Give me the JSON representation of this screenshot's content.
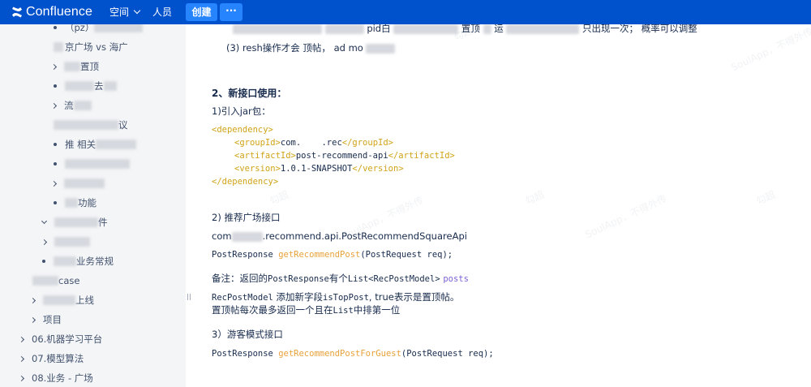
{
  "app": {
    "name": "Confluence",
    "brand_color": "#0052cc",
    "button_color": "#2684ff"
  },
  "topbar": {
    "spaces_label": "空间",
    "people_label": "人员",
    "create_label": "创建",
    "more_label": "···"
  },
  "sidebar": {
    "items": [
      {
        "label": "（pz）",
        "kind": "bullet"
      },
      {
        "label": "京广场 vs 海广",
        "kind": "text"
      },
      {
        "label": "置顶",
        "kind": "caret"
      },
      {
        "label": "去",
        "kind": "bullet"
      },
      {
        "label": "流",
        "kind": "caret"
      },
      {
        "label": "议",
        "kind": "text"
      },
      {
        "label": "推 相关",
        "kind": "bullet"
      },
      {
        "label": "",
        "kind": "bullet"
      },
      {
        "label": "",
        "kind": "caret"
      },
      {
        "label": "功能",
        "kind": "bullet"
      },
      {
        "label": "件",
        "kind": "caret-down"
      },
      {
        "label": "",
        "kind": "caret"
      },
      {
        "label": "业务常规",
        "kind": "bullet"
      },
      {
        "label": "case",
        "kind": "text"
      },
      {
        "label": "上线",
        "kind": "caret"
      },
      {
        "label": "项目",
        "kind": "caret"
      },
      {
        "label": "06.机器学习平台",
        "kind": "caret"
      },
      {
        "label": "07.模型算法",
        "kind": "caret"
      },
      {
        "label": "08.业务 - 广场",
        "kind": "caret"
      }
    ]
  },
  "content": {
    "line_top_a": "pid白",
    "line_top_b": "置顶",
    "line_top_c": "运",
    "line_top_d": "只出现一次； 概率可以调整",
    "line_refresh": "(3)      resh操作才会      顶帖， ad mo      ",
    "section2_title": "2、新接口使用：",
    "step1": "1)引入jar包：",
    "code_dep_open": "<dependency>",
    "code_group_open": "<groupId>",
    "code_group_value": "com.    .rec",
    "code_group_close": "</groupId>",
    "code_artifact_open": "<artifactId>",
    "code_artifact_value": "post-recommend-api",
    "code_artifact_close": "</artifactId>",
    "code_version_open": "<version>",
    "code_version_value": "1.0.1-SNAPSHOT",
    "code_version_close": "</version>",
    "code_dep_close": "</dependency>",
    "step2": "2) 推荐广场接口",
    "api_class_prefix": "com",
    "api_class": ".recommend.api.PostRecommendSquareApi",
    "sig1_type": "PostResponse ",
    "sig1_method": "getRecommendPost",
    "sig1_args": "(PostRequest req);",
    "note_prefix": "备注：返回的",
    "note_type": "PostResponse",
    "note_mid": "有个",
    "note_list": "List<RecPostModel>",
    "note_field": "posts",
    "model_line_a": "RecPostModel",
    "model_line_b": " 添加新字段",
    "model_line_c": "isTopPost",
    "model_line_d": ", true表示是置顶帖。",
    "model_line2_a": "置顶帖每次最多返回一个且在",
    "model_line2_b": "List",
    "model_line2_c": "中排第一位",
    "step3": "3）游客模式接口",
    "sig2_type": "PostResponse ",
    "sig2_method": "getRecommendPostForGuest",
    "sig2_args": "(PostRequest req);"
  },
  "watermarks": [
    "SoulApp，不得外传",
    "勾超",
    "勾超",
    "SoulApp，不得外传",
    "勾超",
    "SoulApp，不得外传",
    "勾超"
  ]
}
